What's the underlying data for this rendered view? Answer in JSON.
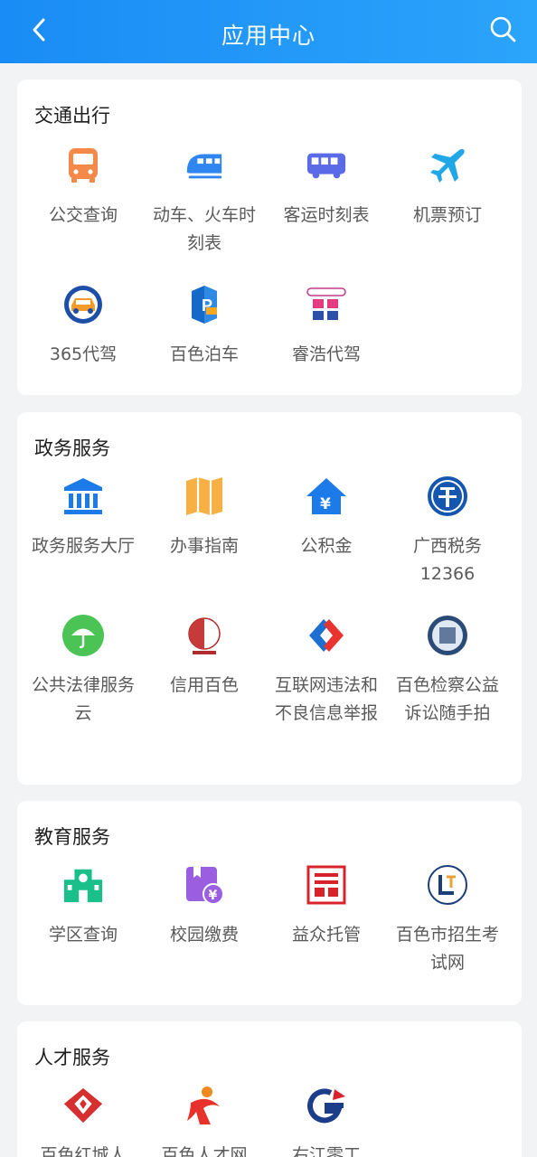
{
  "header": {
    "title": "应用中心"
  },
  "sections": [
    {
      "title": "交通出行",
      "items": [
        {
          "label": "公交查询",
          "icon": "bus-icon"
        },
        {
          "label": "动车、火车时刻表",
          "icon": "train-icon"
        },
        {
          "label": "客运时刻表",
          "icon": "coach-icon"
        },
        {
          "label": "机票预订",
          "icon": "airplane-icon"
        },
        {
          "label": "365代驾",
          "icon": "designated-driver-365-logo"
        },
        {
          "label": "百色泊车",
          "icon": "parking-logo"
        },
        {
          "label": "睿浩代驾",
          "icon": "ruihao-driver-logo"
        }
      ]
    },
    {
      "title": "政务服务",
      "items": [
        {
          "label": "政务服务大厅",
          "icon": "government-building-icon"
        },
        {
          "label": "办事指南",
          "icon": "guide-map-icon"
        },
        {
          "label": "公积金",
          "icon": "housing-fund-icon"
        },
        {
          "label": "广西税务12366",
          "icon": "tax-logo"
        },
        {
          "label": "公共法律服务云",
          "icon": "umbrella-icon"
        },
        {
          "label": "信用百色",
          "icon": "credit-baise-logo"
        },
        {
          "label": "互联网违法和不良信息举报",
          "icon": "report-logo"
        },
        {
          "label": "百色检察公益诉讼随手拍",
          "icon": "procuratorate-logo"
        }
      ]
    },
    {
      "title": "教育服务",
      "items": [
        {
          "label": "学区查询",
          "icon": "school-icon"
        },
        {
          "label": "校园缴费",
          "icon": "campus-payment-icon"
        },
        {
          "label": "益众托管",
          "icon": "yizhong-logo"
        },
        {
          "label": "百色市招生考试网",
          "icon": "exam-logo"
        }
      ]
    },
    {
      "title": "人才服务",
      "items": [
        {
          "label": "百色红城人",
          "icon": "red-city-logo"
        },
        {
          "label": "百色人才网",
          "icon": "talent-logo"
        },
        {
          "label": "右江零工",
          "icon": "gig-logo"
        }
      ]
    }
  ],
  "colors": {
    "header_start": "#1a8cf5",
    "header_end": "#2ba4fb",
    "label_text": "#5a5a5a"
  }
}
